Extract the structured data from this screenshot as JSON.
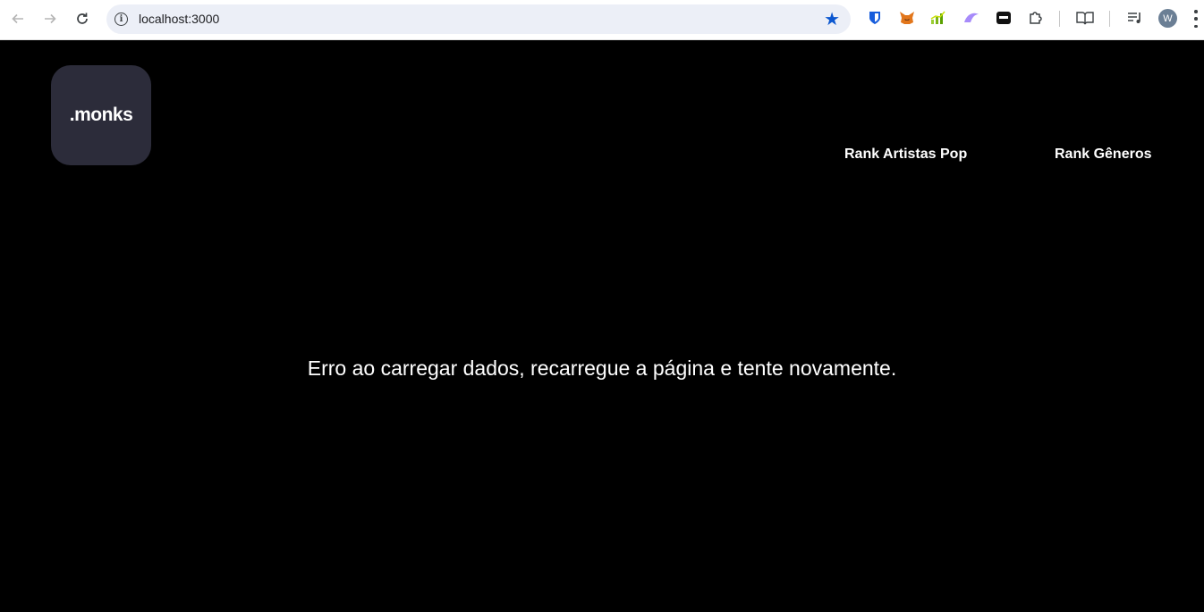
{
  "browser": {
    "url": "localhost:3000",
    "avatar_initial": "W",
    "accent_color": "#0b57d0",
    "extensions": [
      "bitwarden-icon",
      "metamask-icon",
      "chart-extension-icon",
      "wing-extension-icon",
      "wallet-extension-icon",
      "puzzle-extensions-icon"
    ]
  },
  "header": {
    "logo_text": ".monks",
    "nav": [
      {
        "label": "Rank Artistas Pop"
      },
      {
        "label": "Rank Gêneros"
      }
    ]
  },
  "main": {
    "error_message": "Erro ao carregar dados, recarregue a página e tente novamente."
  }
}
